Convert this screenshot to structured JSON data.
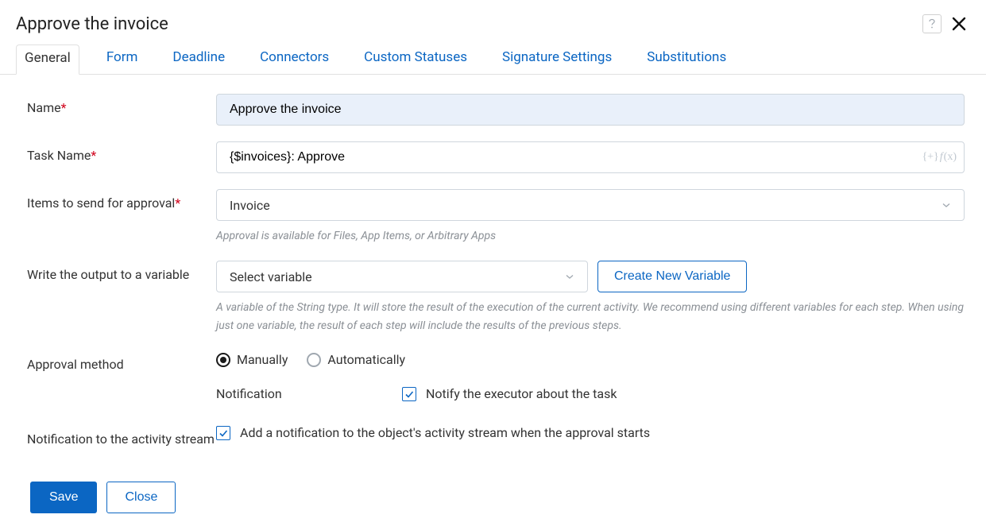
{
  "header": {
    "title": "Approve the invoice"
  },
  "tabs": {
    "general": "General",
    "form": "Form",
    "deadline": "Deadline",
    "connectors": "Connectors",
    "custom_statuses": "Custom Statuses",
    "signature_settings": "Signature Settings",
    "substitutions": "Substitutions"
  },
  "fields": {
    "name": {
      "label": "Name",
      "value": "Approve the invoice"
    },
    "task_name": {
      "label": "Task Name",
      "value": "{$invoices}: Approve"
    },
    "items_to_send": {
      "label": "Items to send for approval",
      "value": "Invoice",
      "hint": "Approval is available for Files, App Items, or Arbitrary Apps"
    },
    "output_variable": {
      "label": "Write the output to a variable",
      "placeholder": "Select variable",
      "create_btn": "Create New Variable",
      "hint": "A variable of the String type. It will store the result of the execution of the current activity. We recommend using different variables for each step. When using just one variable, the result of each step will include the results of the previous steps."
    },
    "approval_method": {
      "label": "Approval method",
      "manually": "Manually",
      "automatically": "Automatically",
      "notification_label": "Notification",
      "notify_executor": "Notify the executor about the task"
    },
    "activity_stream": {
      "label": "Notification to the activity stream",
      "checkbox_label": "Add a notification to the object's activity stream when the approval starts"
    }
  },
  "footer": {
    "save": "Save",
    "close": "Close"
  }
}
